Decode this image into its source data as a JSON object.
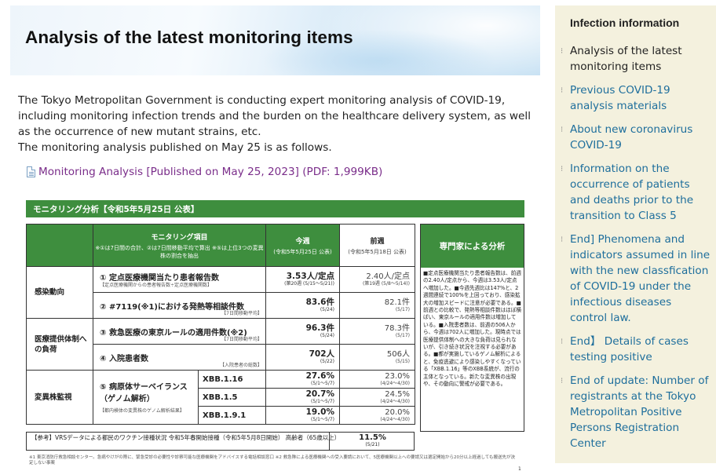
{
  "page": {
    "heading": "Analysis of the latest monitoring items",
    "intro_lines": [
      "The Tokyo Metropolitan Government is conducting expert monitoring analysis of COVID-19, including monitoring infection trends and the burden on the healthcare delivery system, as well as the occurrence of new mutant strains, etc.",
      "The monitoring analysis published on May 25 is as follows."
    ],
    "pdf_link": "Monitoring Analysis [Published on May 25, 2023] (PDF: 1,999KB)",
    "pdf_icon": "document-icon"
  },
  "doc": {
    "title": "モニタリング分析【令和5年5月25日 公表】",
    "headers": {
      "items": "モニタリング項目",
      "items_note": "※①は7日間の合計、②は7日間移動平均で算出 ※⑤は上位3つの変異株の割合を抽出",
      "this_week": "今週",
      "this_week_note": "(令和5年5月25日 公表)",
      "last_week": "前週",
      "last_week_note": "(令和5年5月18日 公表)",
      "expert": "専門家による分析"
    },
    "categories": {
      "infection": "感染動向",
      "medical": "医療提供体制への負荷",
      "variant": "変異株監視"
    },
    "rows": [
      {
        "item": "① 定点医療機関当たり患者報告数",
        "note": "【定点医療機関からの患者報告数÷定点医療機関数】",
        "now": "3.53人/定点",
        "now_date": "(第20週 (5/15～5/21))",
        "prev": "2.40人/定点",
        "prev_date": "(第19週 (5/8～5/14))"
      },
      {
        "item": "② #7119(※1)における発熱等相談件数",
        "note": "【7日間移動平均】",
        "now": "83.6件",
        "now_date": "(5/24)",
        "prev": "82.1件",
        "prev_date": "(5/17)"
      },
      {
        "item": "③ 救急医療の東京ルールの適用件数(※2)",
        "note": "【7日間移動平均】",
        "now": "96.3件",
        "now_date": "(5/24)",
        "prev": "78.3件",
        "prev_date": "(5/17)"
      },
      {
        "item": "④ 入院患者数",
        "note": "【入院患者の総数】",
        "now": "702人",
        "now_date": "(5/22)",
        "prev": "506人",
        "prev_date": "(5/15)"
      }
    ],
    "variant_item": "⑤ 病原体サーベイランス（ゲノム解析）",
    "variant_note": "【都内検体の変異株のゲノム解析結果】",
    "strains": [
      {
        "name": "XBB.1.16",
        "now": "27.6%",
        "now_date": "(5/1～5/7)",
        "prev": "23.0%",
        "prev_date": "(4/24～4/30)"
      },
      {
        "name": "XBB.1.5",
        "now": "20.7%",
        "now_date": "(5/1～5/7)",
        "prev": "24.5%",
        "prev_date": "(4/24～4/30)"
      },
      {
        "name": "XBB.1.9.1",
        "now": "19.0%",
        "now_date": "(5/1～5/7)",
        "prev": "20.0%",
        "prev_date": "(4/24～4/30)"
      }
    ],
    "expert_text": "■定点医療機関当たり患者報告数は、前週の2.40人/定点から、今週は3.53人/定点へ増加した。■今週先週比は147%と、2週間連続で100%を上回っており、感染拡大の増加スピードに注意が必要である。■前週との比較で、発熱等相談件数はほぼ横ばい、東京ルールの適用件数は増加している。■入院患者数は、前週の506人から、今週は702人に増加した。現時点では医療提供体制への大きな負荷は見られないが、引き続き状況を注視する必要がある。■都が実施しているゲノム解析によると、免疫逃避により感染しやすくなっている「XBB.1.16」等のXBB系統が、流行の主体となっている。新たな変異株の出現や、その動向に警戒が必要である。",
    "ref_text": "【参考】VRSデータによる都民のワクチン接種状況 令和5年春開始接種（令和5年5月8日開始） 高齢者（65歳以上）",
    "ref_value": "11.5%",
    "ref_date": "(5/21)",
    "footnote": "※1 東京消防庁救急相談センター。急病やけがの際に、緊急受診の必要性や診察可能な医療機関をアドバイスする電話相談窓口 ※2 救急隊による医療機関への受入要請において、5医療機関以上への要請又は選定開始から20分以上経過しても搬送先が決定しない事案",
    "page_number": "1"
  },
  "sidebar": {
    "title": "Infection information",
    "items": [
      {
        "label": "Analysis of the latest monitoring items",
        "current": true
      },
      {
        "label": "Previous COVID-19 analysis materials"
      },
      {
        "label": "About new coronavirus COVID-19"
      },
      {
        "label": "Information on the occurrence of patients and deaths prior to the transition to Class 5"
      },
      {
        "label": "End] Phenomena and indicators assumed in line with the new classfication of COVID-19 under the infectious diseases control law."
      },
      {
        "label": "End】 Details of cases testing positive"
      },
      {
        "label": "End of update: Number of registrants at the Tokyo Metropolitan Positive Persons Registration Center"
      }
    ]
  }
}
